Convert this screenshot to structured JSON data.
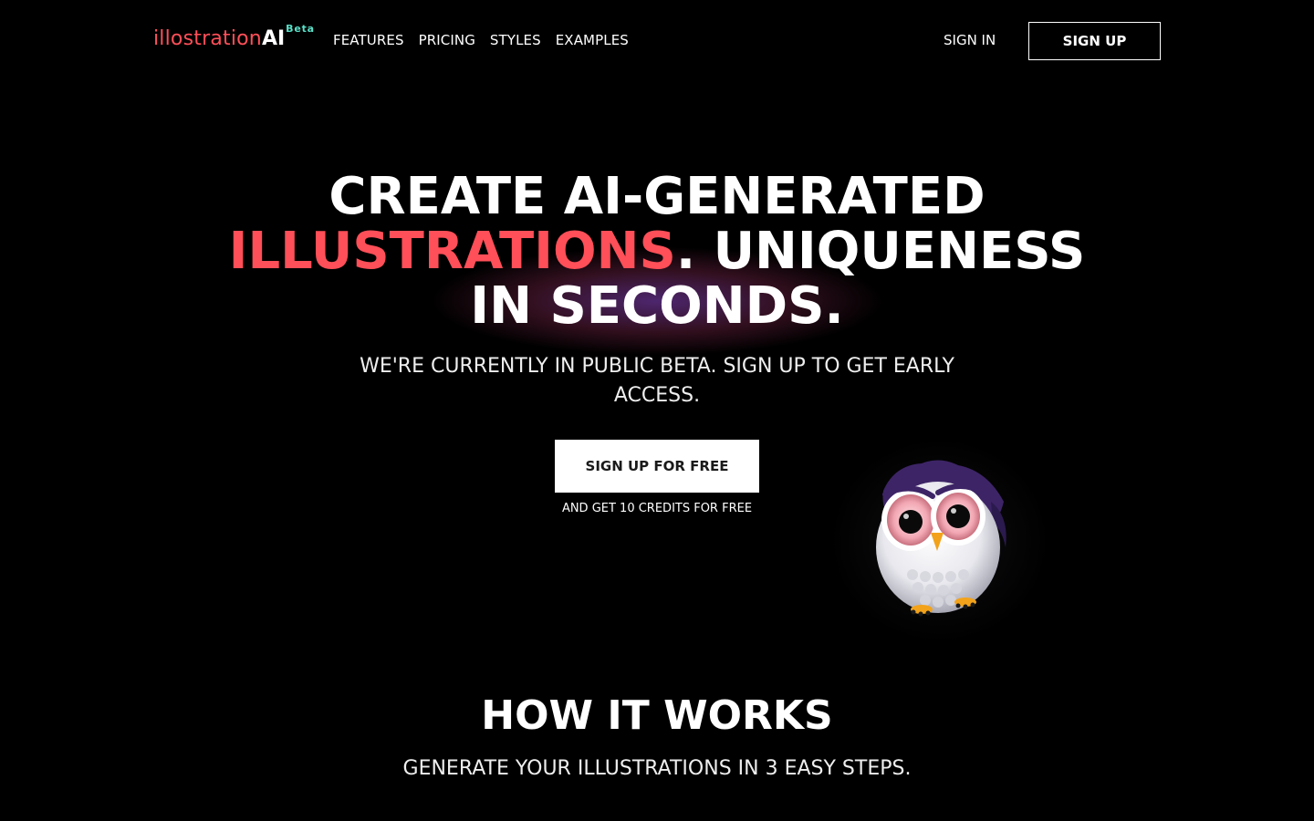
{
  "header": {
    "logo": {
      "main": "illostration",
      "ai": "AI",
      "badge": "Beta"
    },
    "nav": [
      {
        "label": "FEATURES"
      },
      {
        "label": "PRICING"
      },
      {
        "label": "STYLES"
      },
      {
        "label": "EXAMPLES"
      }
    ],
    "sign_in_label": "SIGN IN",
    "sign_up_label": "SIGN UP"
  },
  "hero": {
    "headline_line1": "CREATE AI-GENERATED",
    "headline_accent": "ILLUSTRATIONS",
    "headline_line2_rest": ". UNIQUENESS",
    "headline_line3": "IN SECONDS.",
    "subheading": "WE'RE CURRENTLY IN PUBLIC BETA. SIGN UP TO GET EARLY ACCESS.",
    "cta_label": "SIGN UP FOR FREE",
    "cta_note": "AND GET 10 CREDITS FOR FREE"
  },
  "how_it_works": {
    "title": "HOW IT WORKS",
    "subtitle": "GENERATE YOUR ILLUSTRATIONS IN 3 EASY STEPS."
  },
  "colors": {
    "background": "#000000",
    "accent_red": "#ff4f58",
    "beta_teal": "#59e0c8",
    "text": "#ffffff"
  },
  "icons": {
    "hero_image": "owl-illustration"
  }
}
